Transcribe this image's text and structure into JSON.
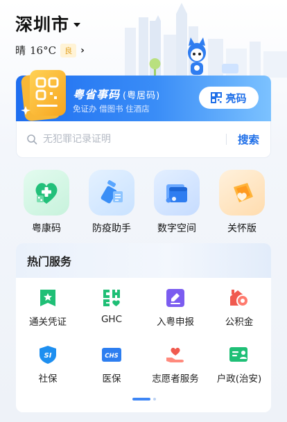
{
  "header": {
    "city": "深圳市",
    "weather": "晴",
    "temperature": "16°C",
    "air_quality": "良"
  },
  "banner": {
    "title": "粤省事码",
    "title_sub": "(粤居码)",
    "subtitle": "免证办 借图书 住酒店",
    "show_code_label": "亮码"
  },
  "search": {
    "placeholder": "无犯罪记录证明",
    "button_label": "搜索"
  },
  "quick_apps": [
    {
      "label": "粤康码",
      "icon": "health-code-icon",
      "color": "#22c07a"
    },
    {
      "label": "防疫助手",
      "icon": "epidemic-helper-icon",
      "color": "#3a8ef6"
    },
    {
      "label": "数字空间",
      "icon": "digital-space-icon",
      "color": "#2f7df0"
    },
    {
      "label": "关怀版",
      "icon": "care-version-icon",
      "color": "#ff9a1f"
    }
  ],
  "hot_services": {
    "title": "热门服务",
    "items": [
      {
        "label": "通关凭证",
        "icon": "customs-voucher-icon",
        "color": "#1fbf76"
      },
      {
        "label": "GHC",
        "icon": "ghc-icon",
        "color": "#1fbf76"
      },
      {
        "label": "入粤申报",
        "icon": "entry-declaration-icon",
        "color": "#7b5cf0"
      },
      {
        "label": "公积金",
        "icon": "housing-fund-icon",
        "color": "#f05a4f"
      },
      {
        "label": "社保",
        "icon": "social-security-icon",
        "color": "#1e8ff0"
      },
      {
        "label": "医保",
        "icon": "medical-insurance-icon",
        "color": "#2d7ef0"
      },
      {
        "label": "志愿者服务",
        "icon": "volunteer-icon",
        "color": "#f05a4f"
      },
      {
        "label": "户政(治安)",
        "icon": "household-registration-icon",
        "color": "#1fbf76"
      }
    ],
    "page_count": 2,
    "current_page": 1
  },
  "icon_texts": {
    "social_security": "SI",
    "medical_insurance": "CHS"
  },
  "colors": {
    "accent": "#1f6fe8",
    "air_quality_text": "#e4a52a",
    "air_quality_bg": "#fff3d6"
  }
}
